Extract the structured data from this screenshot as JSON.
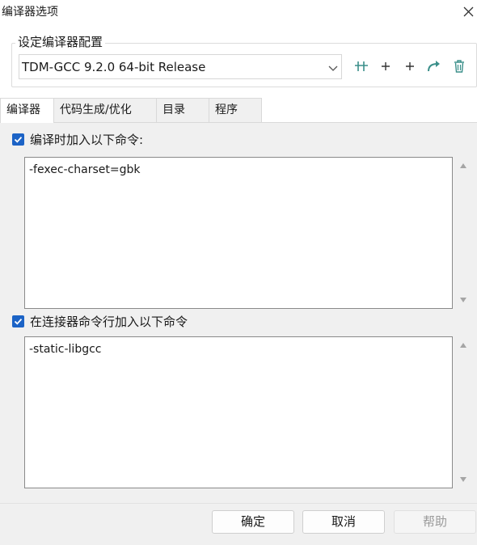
{
  "window": {
    "title": "编译器选项",
    "close_icon": "close-icon"
  },
  "compiler_set": {
    "group_title": "设定编译器配置",
    "selected": "TDM-GCC 9.2.0 64-bit Release",
    "toolbar": [
      {
        "name": "find-compiler-icon",
        "label": "+"
      },
      {
        "name": "add-compiler-icon",
        "label": "+"
      },
      {
        "name": "add-compiler-2-icon",
        "label": "+"
      },
      {
        "name": "rename-arrow-icon",
        "label": ""
      },
      {
        "name": "delete-icon",
        "label": ""
      }
    ]
  },
  "tabs": [
    {
      "label": "编译器",
      "active": true
    },
    {
      "label": "代码生成/优化",
      "active": false
    },
    {
      "label": "目录",
      "active": false
    },
    {
      "label": "程序",
      "active": false
    }
  ],
  "compile_options": {
    "checkbox_label": "编译时加入以下命令:",
    "checked": true,
    "value": "-fexec-charset=gbk"
  },
  "linker_options": {
    "checkbox_label": "在连接器命令行加入以下命令",
    "checked": true,
    "value": "-static-libgcc"
  },
  "buttons": {
    "ok": "确定",
    "cancel": "取消",
    "help": "帮助"
  },
  "colors": {
    "accent": "#1c63c6",
    "icon_teal": "#3b8f8a"
  }
}
